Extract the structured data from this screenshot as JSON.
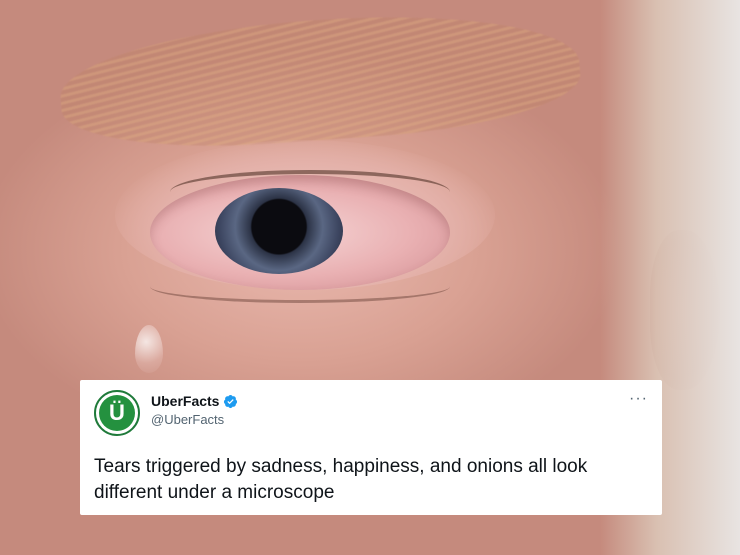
{
  "background": {
    "description_icon": "eye-photo",
    "skin_color": "#d9a193"
  },
  "tweet": {
    "display_name": "UberFacts",
    "handle": "@UberFacts",
    "avatar_letter": "Ü",
    "text": "Tears triggered by sadness, happiness, and onions all look different under a microscope",
    "more_label": "···",
    "brand_color": "#24913f",
    "verified_color": "#1d9bf0"
  }
}
